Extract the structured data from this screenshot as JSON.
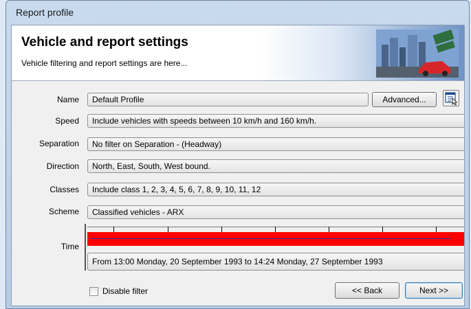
{
  "window": {
    "title": "Report profile"
  },
  "banner": {
    "heading": "Vehicle and report settings",
    "subheading": "Vehicle filtering and report settings are here..."
  },
  "fields": {
    "name": {
      "label": "Name",
      "value": "Default Profile"
    },
    "speed": {
      "label": "Speed",
      "value": "Include vehicles with speeds between 10 km/h and 160 km/h."
    },
    "separation": {
      "label": "Separation",
      "value": "No filter on Separation - (Headway)"
    },
    "direction": {
      "label": "Direction",
      "value": "North, East, South, West bound."
    },
    "classes": {
      "label": "Classes",
      "value": "Include class  1, 2, 3, 4, 5, 6, 7, 8, 9, 10, 11, 12"
    },
    "scheme": {
      "label": "Scheme",
      "value": "Classified vehicles - ARX"
    },
    "time": {
      "label": "Time",
      "value": "From 13:00 Monday, 20 September 1993 to 14:24 Monday, 27 September 1993"
    }
  },
  "buttons": {
    "advanced": "Advanced...",
    "back": "<< Back",
    "next": "Next >>"
  },
  "disable_filter": {
    "label": "Disable filter",
    "checked": false
  },
  "colors": {
    "time_bar": "#ff0000",
    "time_line": "#2d2d9b"
  },
  "icons": {
    "properties": "properties-icon",
    "banner": "city-traffic-image"
  }
}
